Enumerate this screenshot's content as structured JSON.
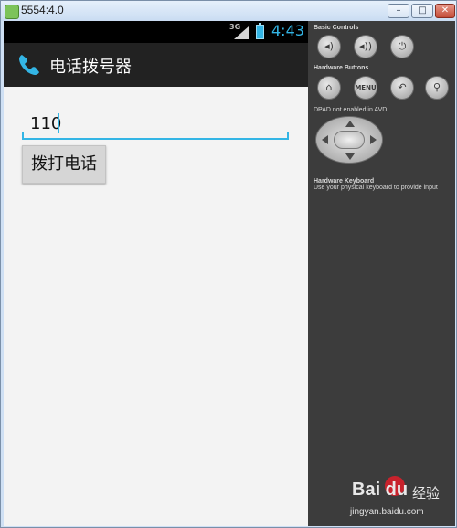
{
  "window": {
    "title": "5554:4.0",
    "minimize_glyph": "–",
    "maximize_glyph": "□",
    "close_glyph": "✕"
  },
  "status_bar": {
    "network": "3G",
    "time": "4:43"
  },
  "app": {
    "title": "电话拨号器",
    "icon": "phone-handset-icon"
  },
  "form": {
    "number_value": "110",
    "call_button_label": "拨打电话"
  },
  "controls": {
    "basic_controls_label": "Basic Controls",
    "hardware_buttons_label": "Hardware Buttons",
    "menu_label": "MENU",
    "dpad_label": "DPAD not enabled in AVD",
    "keyboard_label": "Hardware Keyboard",
    "keyboard_note": "Use your physical keyboard to provide input"
  },
  "watermark": {
    "brand": "Bai du",
    "cn": "经验",
    "url": "jingyan.baidu.com"
  },
  "colors": {
    "accent": "#33b5e5",
    "action_bar": "#222222",
    "panel": "#3c3c3c"
  }
}
